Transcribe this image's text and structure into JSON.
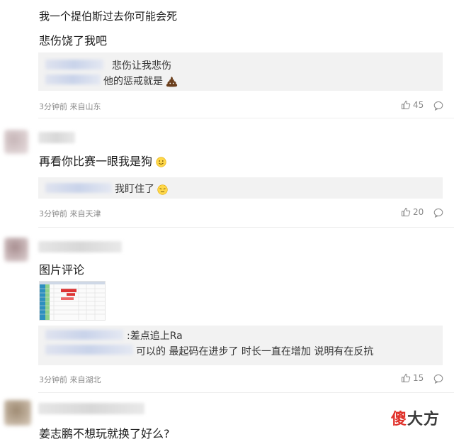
{
  "comments": [
    {
      "text_lines": [
        "我一个提伯斯过去你可能会死",
        "悲伤饶了我吧"
      ],
      "reply_lines": [
        "悲伤让我悲伤",
        "他的惩戒就是"
      ],
      "meta": "3分钟前 来自山东",
      "likes": "45"
    },
    {
      "text": "再看你比赛一眼我是狗",
      "reply_lines": [
        "我盯住了"
      ],
      "meta": "3分钟前 来自天津",
      "likes": "20"
    },
    {
      "text": "图片评论",
      "reply_lines": [
        ":差点追上Ra",
        "可以的 最起码在进步了 时长一直在增加 说明有在反抗"
      ],
      "meta": "3分钟前 来自湖北",
      "likes": "15"
    },
    {
      "text": "姜志鹏不想玩就换了好么?"
    }
  ],
  "icons": {
    "like": "thumbs-up-icon",
    "comment": "comment-bubble-icon",
    "poop": "poop-emoji-icon",
    "smile": "smile-emoji-icon",
    "sneaky": "sneaky-emoji-icon"
  },
  "watermark": {
    "part1": "傻",
    "part2": "大方"
  },
  "colors": {
    "watermark_red": "#e0322b",
    "reply_bg": "#f2f2f2"
  }
}
